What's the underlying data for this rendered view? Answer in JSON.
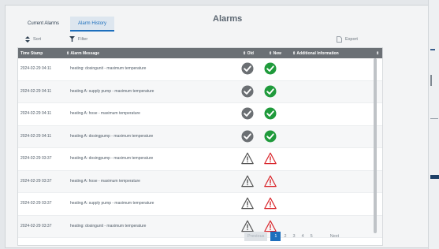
{
  "tabs": [
    {
      "label": "Current Alarms",
      "active": false
    },
    {
      "label": "Alarm History",
      "active": true
    }
  ],
  "title": "Alarms",
  "toolbar": {
    "sort_label": "Sort",
    "filter_label": "Filter",
    "export_label": "Export"
  },
  "columns": {
    "timestamp": "Time Stamp",
    "message": "Alarm Message",
    "old": "Old",
    "new": "New",
    "info": "Additional Information"
  },
  "rows": [
    {
      "time": "2024-02-29 04:11",
      "message": "heating: dosingunit - maximum temperature",
      "old": "check",
      "new": "check"
    },
    {
      "time": "2024-02-29 04:11",
      "message": "heating A: supply pump - maximum temperature",
      "old": "check",
      "new": "check"
    },
    {
      "time": "2024-02-29 04:11",
      "message": "heating A: hose - maximum temperature",
      "old": "check",
      "new": "check"
    },
    {
      "time": "2024-02-29 04:11",
      "message": "heating A: dosingpump - maximum temperature",
      "old": "check",
      "new": "check"
    },
    {
      "time": "2024-02-29 03:37",
      "message": "heating A: dosingpump - maximum temperature",
      "old": "warning",
      "new": "warning"
    },
    {
      "time": "2024-02-29 03:37",
      "message": "heating A: hose - maximum temperature",
      "old": "warning",
      "new": "warning"
    },
    {
      "time": "2024-02-29 03:37",
      "message": "heating A: supply pump - maximum temperature",
      "old": "warning",
      "new": "warning"
    },
    {
      "time": "2024-02-29 03:37",
      "message": "heating: dosingunit - maximum temperature",
      "old": "warning",
      "new": "warning"
    }
  ],
  "pagination": {
    "previous": "Previous",
    "pages": [
      "1",
      "2",
      "3",
      "4",
      "5"
    ],
    "current": "1",
    "next": "Next"
  },
  "colors": {
    "accent": "#1d6fbd",
    "ok_old": "#6b6f73",
    "ok_new": "#1f9a3b",
    "warn_old": "#555555",
    "warn_new": "#d9262c"
  }
}
